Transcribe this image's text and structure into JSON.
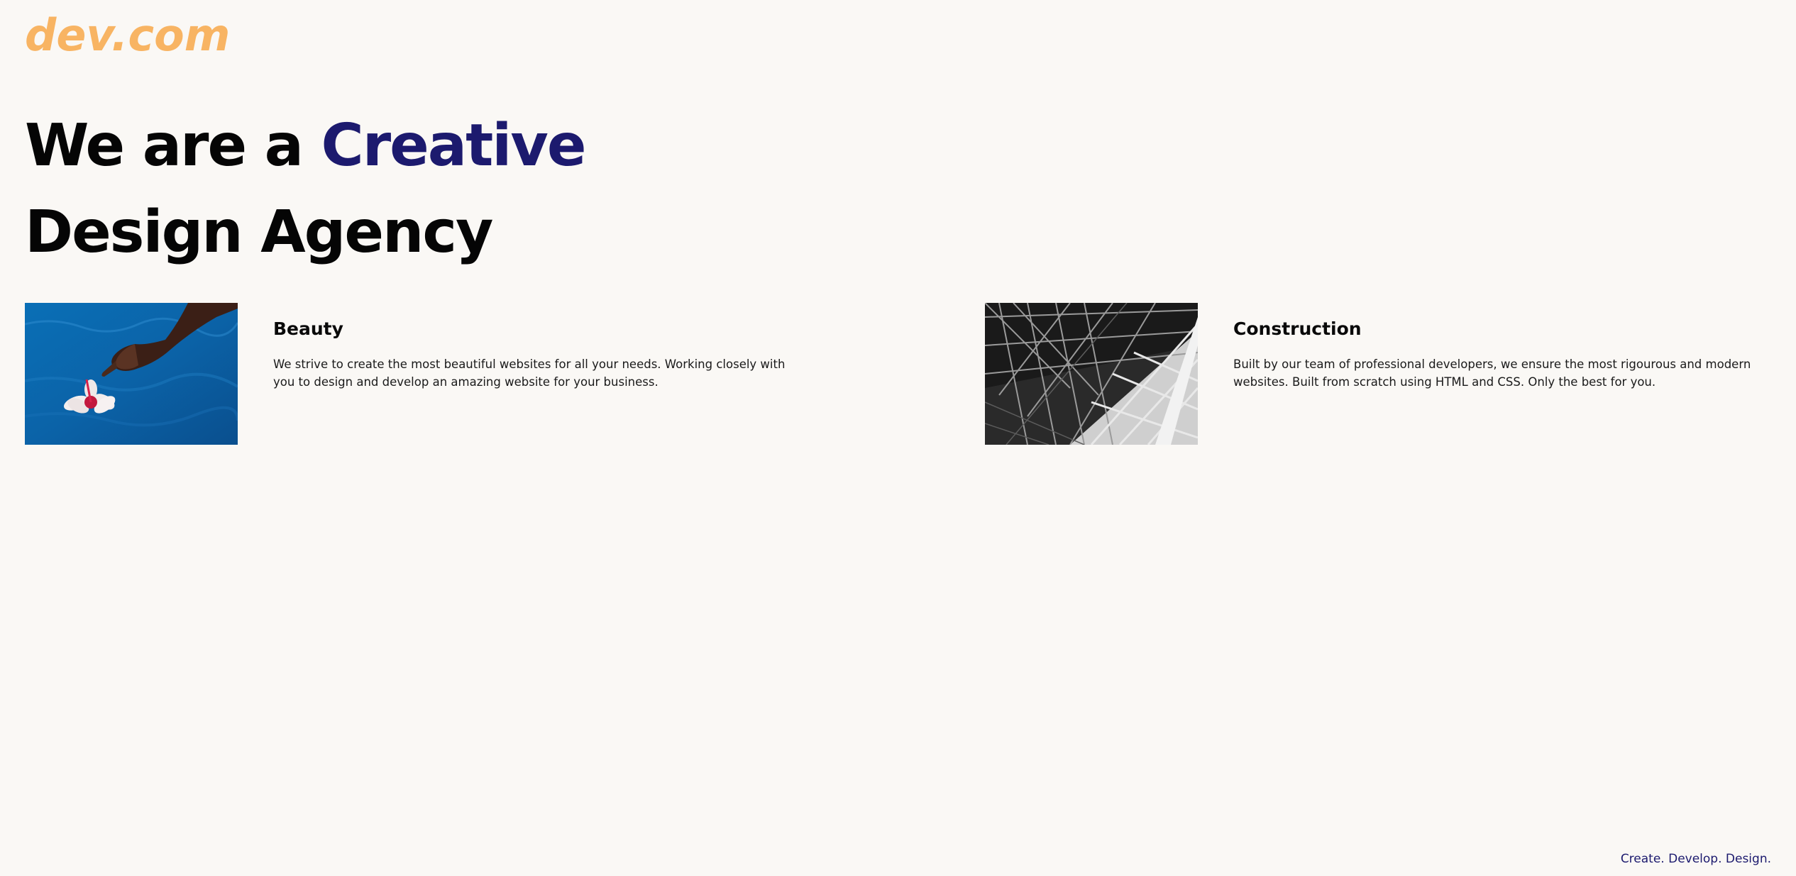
{
  "brand": {
    "logo_text": "dev.com",
    "logo_color": "#f8b463"
  },
  "hero": {
    "prefix": "We are a",
    "accent": "Creative",
    "line2": "Design Agency",
    "accent_color": "#1c1a6e"
  },
  "features": [
    {
      "title": "Beauty",
      "description": "We strive to create the most beautiful websites for all your needs. Working closely with you to design and develop an amazing website for your business.",
      "image": "hand-flower-water-photo"
    },
    {
      "title": "Construction",
      "description": "Built by our team of professional developers, we ensure the most rigourous and modern websites. Built from scratch using HTML and CSS. Only the best for you.",
      "image": "steel-structure-photo"
    }
  ],
  "footer": {
    "tagline": "Create. Develop. Design."
  }
}
